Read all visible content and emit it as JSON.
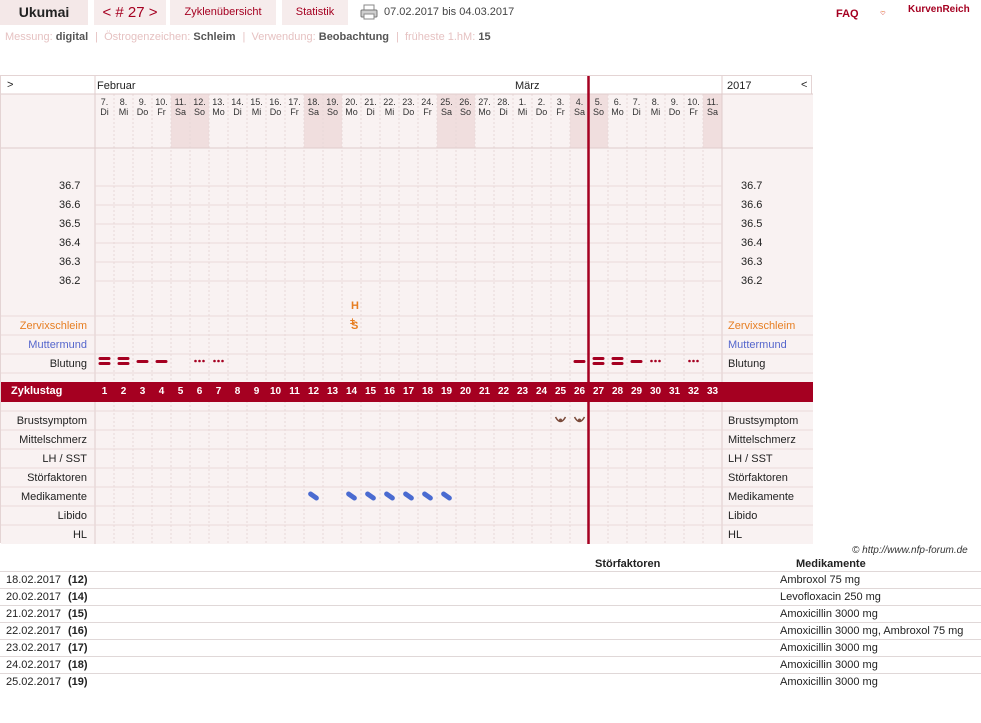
{
  "header": {
    "user": "Ukumai",
    "cycle_prev": "<",
    "cycle_label": "# 27",
    "cycle_next": ">",
    "tab_overview": "Zyklenübersicht",
    "tab_stats": "Statistik",
    "date_range": "07.02.2017 bis 04.03.2017",
    "faq": "FAQ",
    "logo": "KurvenReich"
  },
  "settings": {
    "measure_label": "Messung:",
    "measure_value": "digital",
    "estrogen_label": "Östrogenzeichen:",
    "estrogen_value": "Schleim",
    "use_label": "Verwendung:",
    "use_value": "Beobachtung",
    "earliest_label": "früheste 1.hM:",
    "earliest_value": "15"
  },
  "chart": {
    "nav_left": ">",
    "nav_right": "<",
    "month_feb": "Februar",
    "month_mar": "März",
    "year": "2017",
    "days": [
      {
        "n": "7.",
        "w": "Di",
        "we": false
      },
      {
        "n": "8.",
        "w": "Mi",
        "we": false
      },
      {
        "n": "9.",
        "w": "Do",
        "we": false
      },
      {
        "n": "10.",
        "w": "Fr",
        "we": false
      },
      {
        "n": "11.",
        "w": "Sa",
        "we": true
      },
      {
        "n": "12.",
        "w": "So",
        "we": true
      },
      {
        "n": "13.",
        "w": "Mo",
        "we": false
      },
      {
        "n": "14.",
        "w": "Di",
        "we": false
      },
      {
        "n": "15.",
        "w": "Mi",
        "we": false
      },
      {
        "n": "16.",
        "w": "Do",
        "we": false
      },
      {
        "n": "17.",
        "w": "Fr",
        "we": false
      },
      {
        "n": "18.",
        "w": "Sa",
        "we": true
      },
      {
        "n": "19.",
        "w": "So",
        "we": true
      },
      {
        "n": "20.",
        "w": "Mo",
        "we": false
      },
      {
        "n": "21.",
        "w": "Di",
        "we": false
      },
      {
        "n": "22.",
        "w": "Mi",
        "we": false
      },
      {
        "n": "23.",
        "w": "Do",
        "we": false
      },
      {
        "n": "24.",
        "w": "Fr",
        "we": false
      },
      {
        "n": "25.",
        "w": "Sa",
        "we": true
      },
      {
        "n": "26.",
        "w": "So",
        "we": true
      },
      {
        "n": "27.",
        "w": "Mo",
        "we": false
      },
      {
        "n": "28.",
        "w": "Di",
        "we": false
      },
      {
        "n": "1.",
        "w": "Mi",
        "we": false
      },
      {
        "n": "2.",
        "w": "Do",
        "we": false
      },
      {
        "n": "3.",
        "w": "Fr",
        "we": false
      },
      {
        "n": "4.",
        "w": "Sa",
        "we": true
      },
      {
        "n": "5.",
        "w": "So",
        "we": true
      },
      {
        "n": "6.",
        "w": "Mo",
        "we": false
      },
      {
        "n": "7.",
        "w": "Di",
        "we": false
      },
      {
        "n": "8.",
        "w": "Mi",
        "we": false
      },
      {
        "n": "9.",
        "w": "Do",
        "we": false
      },
      {
        "n": "10.",
        "w": "Fr",
        "we": false
      },
      {
        "n": "11.",
        "w": "Sa",
        "we": true
      }
    ],
    "temps": [
      "36.7",
      "36.6",
      "36.5",
      "36.4",
      "36.3",
      "36.2"
    ],
    "obs_letter_h": "H",
    "obs_letter_s": "S",
    "obs_letter_pm": "±",
    "labels": {
      "zervix": "Zervixschleim",
      "muttermund": "Muttermund",
      "blutung": "Blutung",
      "zyklustag": "Zyklustag",
      "brust": "Brustsymptom",
      "mittel": "Mittelschmerz",
      "lh": "LH / SST",
      "stoer": "Störfaktoren",
      "medi": "Medikamente",
      "libido": "Libido",
      "hl": "HL"
    },
    "colors": {
      "accent": "#a50021",
      "zervix": "#e67e22",
      "muttermund": "#5566cc",
      "pill": "#4a6bd1"
    }
  },
  "footer": {
    "copyright": "© http://www.nfp-forum.de",
    "head_stoer": "Störfaktoren",
    "head_medi": "Medikamente",
    "rows": [
      {
        "date": "18.02.2017",
        "day": "(12)",
        "med": "Ambroxol 75 mg"
      },
      {
        "date": "20.02.2017",
        "day": "(14)",
        "med": "Levofloxacin 250 mg"
      },
      {
        "date": "21.02.2017",
        "day": "(15)",
        "med": "Amoxicillin 3000 mg"
      },
      {
        "date": "22.02.2017",
        "day": "(16)",
        "med": "Amoxicillin 3000 mg, Ambroxol 75 mg"
      },
      {
        "date": "23.02.2017",
        "day": "(17)",
        "med": "Amoxicillin 3000 mg"
      },
      {
        "date": "24.02.2017",
        "day": "(18)",
        "med": "Amoxicillin 3000 mg"
      },
      {
        "date": "25.02.2017",
        "day": "(19)",
        "med": "Amoxicillin 3000 mg"
      }
    ]
  }
}
